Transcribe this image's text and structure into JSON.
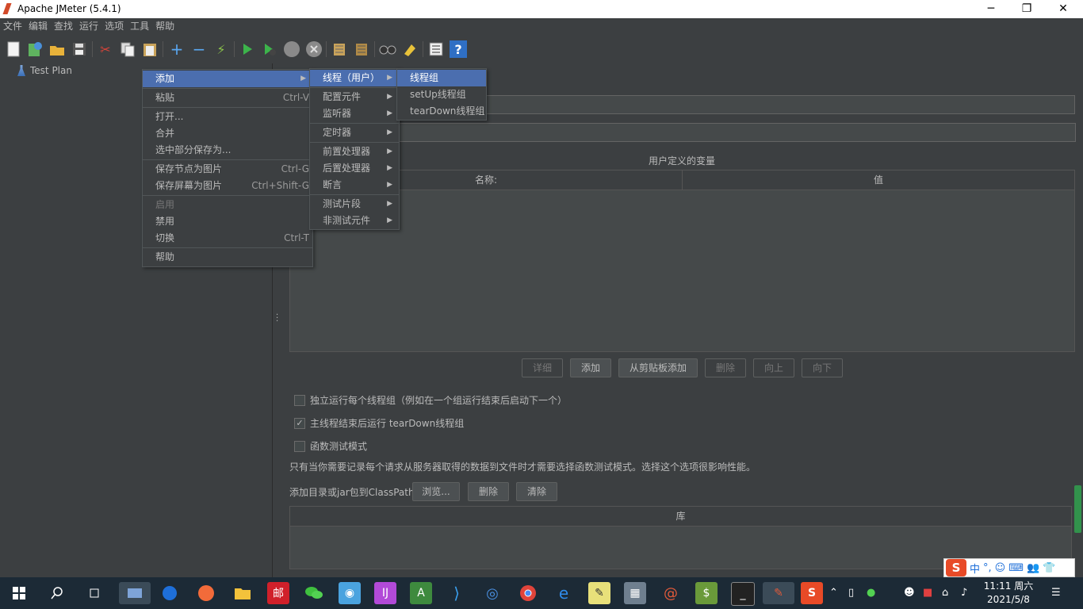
{
  "window": {
    "title": "Apache JMeter (5.4.1)",
    "controls": [
      "─",
      "❐",
      "✕"
    ]
  },
  "menubar": [
    "文件",
    "编辑",
    "查找",
    "运行",
    "选项",
    "工具",
    "帮助"
  ],
  "tree": {
    "root": "Test Plan"
  },
  "main": {
    "variables_title": "用户定义的变量",
    "columns": [
      "名称:",
      "值"
    ],
    "buttons": {
      "detail": "详细",
      "add": "添加",
      "add_clipboard": "从剪贴板添加",
      "delete": "删除",
      "up": "向上",
      "down": "向下"
    },
    "checkboxes": [
      {
        "label": "独立运行每个线程组（例如在一个组运行结束后启动下一个）",
        "checked": false
      },
      {
        "label": "主线程结束后运行 tearDown线程组",
        "checked": true
      },
      {
        "label": "函数测试模式",
        "checked": false
      }
    ],
    "functional_note": "只有当你需要记录每个请求从服务器取得的数据到文件时才需要选择函数测试模式。选择这个选项很影响性能。",
    "classpath_label": "添加目录或jar包到ClassPath",
    "classpath_buttons": {
      "browse": "浏览...",
      "delete": "删除",
      "clear": "清除"
    },
    "library_header": "库"
  },
  "context_menu": {
    "items": [
      {
        "label": "添加",
        "shortcut": ""
      },
      {
        "label": "粘贴",
        "shortcut": "Ctrl-V"
      },
      {
        "label": "打开...",
        "shortcut": ""
      },
      {
        "label": "合并",
        "shortcut": ""
      },
      {
        "label": "选中部分保存为...",
        "shortcut": ""
      },
      {
        "label": "保存节点为图片",
        "shortcut": "Ctrl-G"
      },
      {
        "label": "保存屏幕为图片",
        "shortcut": "Ctrl+Shift-G"
      },
      {
        "label": "启用",
        "shortcut": ""
      },
      {
        "label": "禁用",
        "shortcut": ""
      },
      {
        "label": "切换",
        "shortcut": "Ctrl-T"
      },
      {
        "label": "帮助",
        "shortcut": ""
      }
    ]
  },
  "add_submenu": {
    "items": [
      "线程（用户）",
      "配置元件",
      "监听器",
      "定时器",
      "前置处理器",
      "后置处理器",
      "断言",
      "测试片段",
      "非测试元件"
    ]
  },
  "thread_submenu": {
    "items": [
      "线程组",
      "setUp线程组",
      "tearDown线程组"
    ]
  },
  "ime": {
    "items": [
      "中",
      "°,",
      "☺",
      "⌨",
      "👥",
      "👕"
    ]
  },
  "taskbar": {
    "clock_time": "11:11 周六",
    "clock_date": "2021/5/8"
  },
  "colors": {
    "background": "#3c3f41",
    "selection": "#4b6eaf",
    "taskbar": "#1c2a36"
  }
}
